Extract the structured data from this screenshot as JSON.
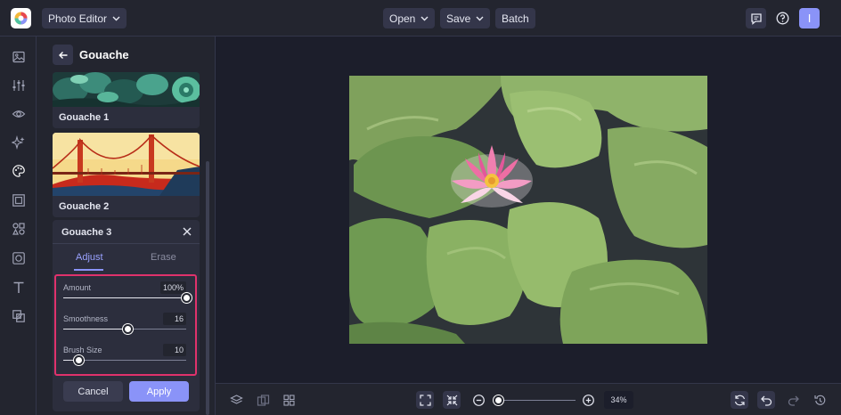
{
  "topbar": {
    "app_menu_label": "Photo Editor",
    "open_label": "Open",
    "save_label": "Save",
    "batch_label": "Batch",
    "avatar_initial": "I"
  },
  "rail": {
    "icons": [
      "image-icon",
      "adjust-sliders-icon",
      "eye-icon",
      "sparkle-effects-icon",
      "palette-icon",
      "frame-icon",
      "graphics-icon",
      "texture-icon",
      "text-icon",
      "overlay-icon"
    ]
  },
  "panel": {
    "title": "Gouache",
    "thumbnails": [
      {
        "label": "Gouache 1"
      },
      {
        "label": "Gouache 2"
      }
    ],
    "effect_card": {
      "title": "Gouache 3",
      "tabs": [
        "Adjust",
        "Erase"
      ],
      "active_tab": "Adjust",
      "sliders": [
        {
          "label": "Amount",
          "value": "100%",
          "fraction": 1.0
        },
        {
          "label": "Smoothness",
          "value": "16",
          "fraction": 0.52
        },
        {
          "label": "Brush Size",
          "value": "10",
          "fraction": 0.12
        }
      ],
      "cancel_label": "Cancel",
      "apply_label": "Apply"
    }
  },
  "bottombar": {
    "zoom_value": "34%",
    "zoom_fraction": 0.0
  },
  "colors": {
    "accent": "#8a93f8",
    "highlight": "#e0326c",
    "background": "#1c1e2b",
    "panel": "#23252f"
  }
}
